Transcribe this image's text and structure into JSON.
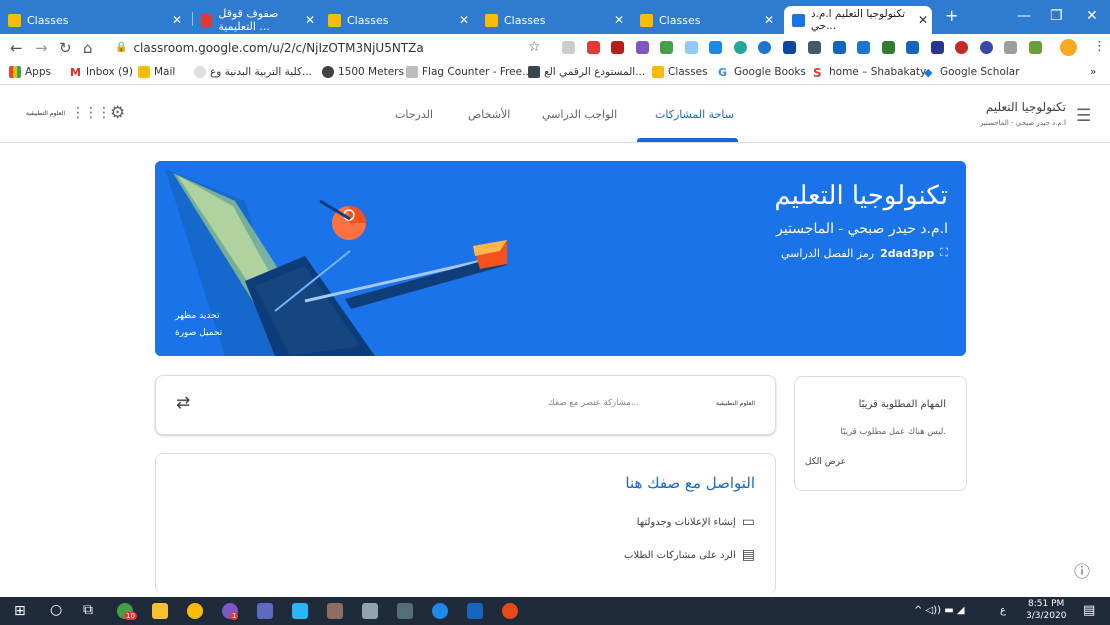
{
  "browser": {
    "tabs": [
      {
        "title": "Classes",
        "active": false
      },
      {
        "title": "صفوف قوقل التعليمية ...",
        "active": false
      },
      {
        "title": "Classes",
        "active": false
      },
      {
        "title": "Classes",
        "active": false
      },
      {
        "title": "Classes",
        "active": false
      },
      {
        "title": "تكنولوجيا التعليم ا.م.د حي...",
        "active": true
      }
    ],
    "new_tab": "+",
    "url": "classroom.google.com/u/2/c/NjIzOTM3NjU5NTZa",
    "bookmarks": [
      "Apps",
      "Inbox (9)",
      "Mail",
      "كلية التربية البدنية وع...",
      "1500 Meters",
      "Flag Counter - Free...",
      "المستودع الرقمي الع...",
      "Classes",
      "Google Books",
      "home – Shabakaty",
      "Google Scholar"
    ],
    "bookmarks_more": "»"
  },
  "classroom": {
    "header_title": "تكنولوجيا التعليم",
    "header_subtitle": "ا.م.د حيدر صبحي - الماجستير",
    "account_label": "العلوم التطبيقية",
    "tabs": [
      "ساحة المشاركات",
      "الواجب الدراسي",
      "الأشخاص",
      "الدرجات"
    ],
    "active_tab": "ساحة المشاركات"
  },
  "banner": {
    "title": "تكنولوجيا التعليم",
    "subtitle": "ا.م.د حيدر صبحي - الماجستير",
    "class_code_label": "رمز الفصل الدراسي",
    "class_code": "2dad3pp",
    "select_theme": "تحديد مظهر",
    "upload_photo": "تحميل صورة"
  },
  "upcoming": {
    "title": "المهام المطلوبة قريبًا",
    "note": "ليس هناك عمل مطلوب قريبًا.",
    "view_all": "عرض الكل"
  },
  "share": {
    "account_label": "العلوم التطبيقية",
    "placeholder": "مشاركة عنصر مع صفك..."
  },
  "communicate": {
    "title": "التواصل مع صفك هنا",
    "items": [
      "إنشاء الإعلانات وجدولتها",
      "الرد على مشاركات الطلاب"
    ]
  },
  "taskbar": {
    "time": "8:51 PM",
    "date": "3/3/2020",
    "lang": "ع",
    "badge_whatsapp": "10",
    "badge_viber": "1"
  }
}
